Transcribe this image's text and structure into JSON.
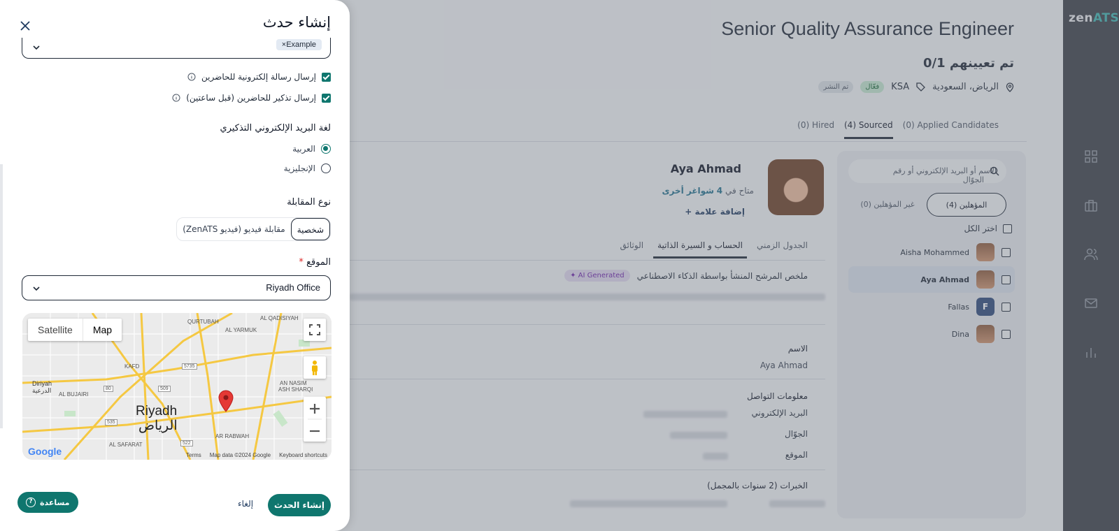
{
  "app": {
    "logo_prefix": "zen",
    "logo_suffix": "ATS",
    "job_title": "Senior Quality Assurance Engineer",
    "hired_count": "0/1 تم تعيينهم",
    "location": "الرياض، السعودية",
    "tag": "KSA",
    "status_active": "فعّال",
    "status_published": "تم النشر",
    "tabs": [
      "(0) Applied Candidates",
      "(4) Sourced",
      "(0) Hired"
    ],
    "search_placeholder": "الاسم أو البريد الإلكتروني أو رقم الجوّال",
    "qualified_tab": "المؤهلين (4)",
    "unqualified_tab": "غير المؤهلين (0)",
    "select_all": "اختر الكل",
    "candidates": [
      {
        "name": "Aisha Mohammed"
      },
      {
        "name": "Aya Ahmad"
      },
      {
        "name": "Fallas",
        "initial": "F"
      },
      {
        "name": "Dina"
      }
    ],
    "profile": {
      "name": "Aya Ahmad",
      "available_prefix": "متاح في",
      "available_count": "4",
      "available_suffix": "شواغر أخرى",
      "add_tag": "إضافة علامة",
      "tabs": [
        "الجدول الزمني",
        "الحساب و السيرة الذاتية",
        "الوثائق"
      ],
      "ai_summary_label": "ملخص المرشح المنشأ بواسطة الذكاء الاصطناعي",
      "ai_badge": "AI Generated",
      "name_label": "الاسم",
      "name_value": "Aya Ahmad",
      "contact_label": "معلومات التواصل",
      "email_label": "البريد الإلكتروني",
      "phone_label": "الجوّال",
      "location_label": "الموقع",
      "experience_label": "الخبرات (2 سنوات بالمجمل)"
    }
  },
  "drawer": {
    "title": "إنشاء حدث",
    "tag_chip": "Example",
    "send_email": "إرسال رسالة إلكترونية للحاضرين",
    "send_reminder": "إرسال تذكير للحاضرين (قبل ساعتين)",
    "reminder_lang_label": "لغة البريد الإلكتروني التذكيري",
    "lang_options": [
      "العربية",
      "الإنجليزية"
    ],
    "interview_type_label": "نوع المقابلة",
    "interview_types": [
      "شخصية",
      "مقابلة فيديو (فيديو ZenATS)"
    ],
    "location_label": "الموقع",
    "location_value": "Riyadh Office",
    "map": {
      "satellite": "Satellite",
      "map": "Map",
      "city_en": "Riyadh",
      "city_ar": "الرياض",
      "labels": [
        "AL QADISIYAH",
        "QURTUBAH",
        "AL YARMUK",
        "KAFD",
        "Diriyah",
        "الدرعية",
        "AL BUJAIRI",
        "AN NASIM",
        "ASH SHARQI",
        "AL SAFARAT",
        "AR RABWAH"
      ],
      "roads": [
        "5735",
        "80",
        "509",
        "535",
        "522"
      ],
      "footer": [
        "Keyboard shortcuts",
        "Map data ©2024 Google",
        "Terms"
      ],
      "google": "Google"
    },
    "create_button": "إنشاء الحدث",
    "cancel_button": "إلغاء"
  },
  "help_button": "مساعدة",
  "colors": {
    "primary": "#0f766e",
    "sidebar": "#3a3f47",
    "accent": "#3fb3b0"
  }
}
